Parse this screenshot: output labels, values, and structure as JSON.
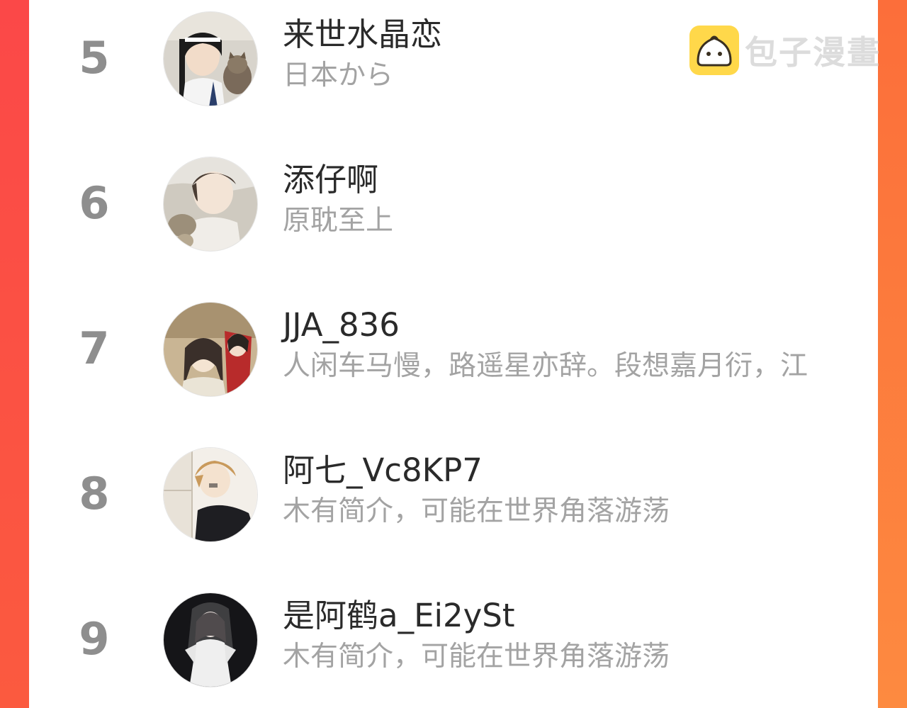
{
  "watermark": {
    "text": "包子漫畫",
    "icon": "bun-icon",
    "icon_color": "#ffd84a"
  },
  "ranking": [
    {
      "rank": "5",
      "name": "来世水晶恋",
      "bio": "日本から",
      "avatar": "user-avatar"
    },
    {
      "rank": "6",
      "name": "添仔啊",
      "bio": "原耽至上",
      "avatar": "user-avatar"
    },
    {
      "rank": "7",
      "name": "JJA_836",
      "bio": "人闲车马慢，路遥星亦辞。段想嘉月衍，江",
      "avatar": "user-avatar"
    },
    {
      "rank": "8",
      "name": "阿七_Vc8KP7",
      "bio": "木有简介，可能在世界角落游荡",
      "avatar": "user-avatar"
    },
    {
      "rank": "9",
      "name": "是阿鹤a_Ei2ySt",
      "bio": "木有简介，可能在世界角落游荡",
      "avatar": "user-avatar"
    }
  ],
  "colors": {
    "accent_left": "#fb4a4a",
    "accent_right": "#fc7c3a",
    "rank_text": "#8e8e8e",
    "name_text": "#2a2a2a",
    "bio_text": "#a3a3a3"
  }
}
